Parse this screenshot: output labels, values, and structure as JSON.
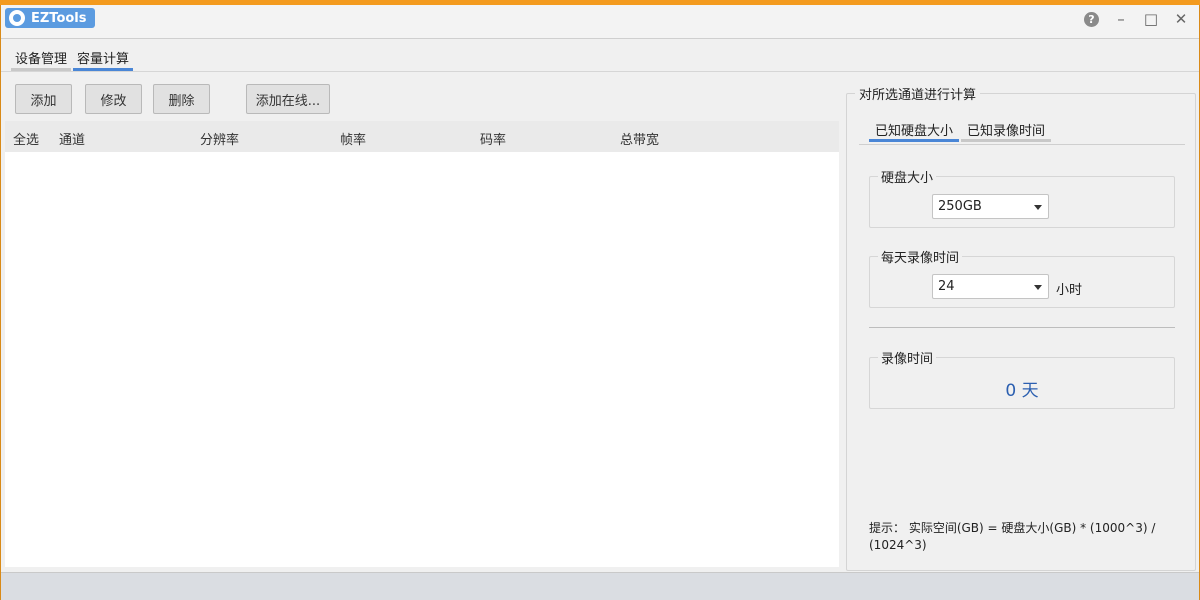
{
  "window": {
    "app_name": "EZTools",
    "help_label": "?",
    "minimize_label": "–",
    "maximize_label": "□",
    "close_label": "✕"
  },
  "tabs": [
    {
      "label": "设备管理",
      "active": false
    },
    {
      "label": "容量计算",
      "active": true
    }
  ],
  "toolbar": {
    "add": "添加",
    "edit": "修改",
    "delete": "删除",
    "add_online": "添加在线..."
  },
  "table": {
    "columns": [
      "全选",
      "通道",
      "分辨率",
      "帧率",
      "码率",
      "总带宽"
    ],
    "rows": []
  },
  "calc_panel": {
    "title": "对所选通道进行计算",
    "tabs": [
      {
        "label": "已知硬盘大小",
        "active": true
      },
      {
        "label": "已知录像时间",
        "active": false
      }
    ],
    "disk_size": {
      "label": "硬盘大小",
      "value": "250GB"
    },
    "daily_record": {
      "label": "每天录像时间",
      "value": "24",
      "unit": "小时"
    },
    "record_time": {
      "label": "录像时间",
      "value": "0",
      "unit": "天"
    },
    "hint": "提示：  实际空间(GB) = 硬盘大小(GB) * (1000^3) / (1024^3)"
  },
  "colors": {
    "accent": "#4a86d6",
    "brand": "#5b9be0",
    "result_text": "#2b5fb0",
    "frame": "#f39a1e"
  }
}
